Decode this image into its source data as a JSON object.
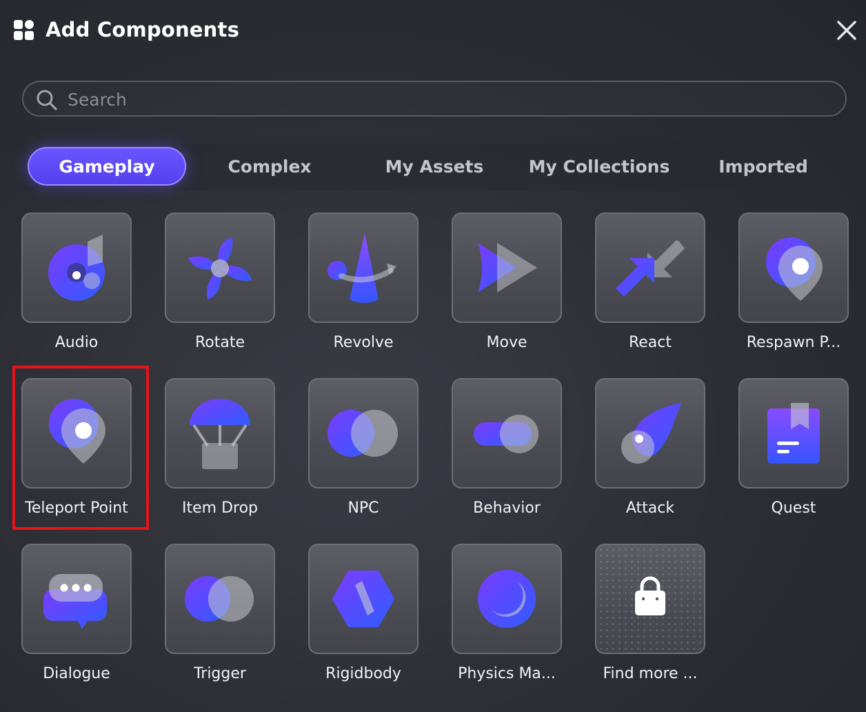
{
  "header": {
    "title": "Add Components",
    "logo_icon": "grid-icon",
    "close_icon": "close-icon"
  },
  "search": {
    "placeholder": "Search",
    "value": ""
  },
  "tabs": [
    {
      "label": "Gameplay",
      "active": true
    },
    {
      "label": "Complex",
      "active": false
    },
    {
      "label": "My Assets",
      "active": false
    },
    {
      "label": "My Collections",
      "active": false
    },
    {
      "label": "Imported",
      "active": false
    }
  ],
  "components": [
    {
      "label": "Audio",
      "icon": "audio-icon"
    },
    {
      "label": "Rotate",
      "icon": "fan-icon"
    },
    {
      "label": "Revolve",
      "icon": "revolve-icon"
    },
    {
      "label": "Move",
      "icon": "move-icon"
    },
    {
      "label": "React",
      "icon": "react-arrows-icon"
    },
    {
      "label": "Respawn P...",
      "icon": "location-pin-icon"
    },
    {
      "label": "Teleport Point",
      "icon": "location-pin-icon",
      "highlighted": true
    },
    {
      "label": "Item Drop",
      "icon": "parachute-icon"
    },
    {
      "label": "NPC",
      "icon": "npc-circles-icon"
    },
    {
      "label": "Behavior",
      "icon": "toggle-icon"
    },
    {
      "label": "Attack",
      "icon": "comet-icon"
    },
    {
      "label": "Quest",
      "icon": "quest-book-icon"
    },
    {
      "label": "Dialogue",
      "icon": "chat-bubble-icon"
    },
    {
      "label": "Trigger",
      "icon": "trigger-circles-icon"
    },
    {
      "label": "Rigidbody",
      "icon": "hexagon-icon"
    },
    {
      "label": "Physics Ma...",
      "icon": "moon-icon"
    },
    {
      "label": "Find more ...",
      "icon": "lock-icon"
    }
  ],
  "colors": {
    "accent": "#5a45f5",
    "accent_border": "#9b8cff",
    "highlight": "#e8121a",
    "background": "#2c2d34"
  }
}
